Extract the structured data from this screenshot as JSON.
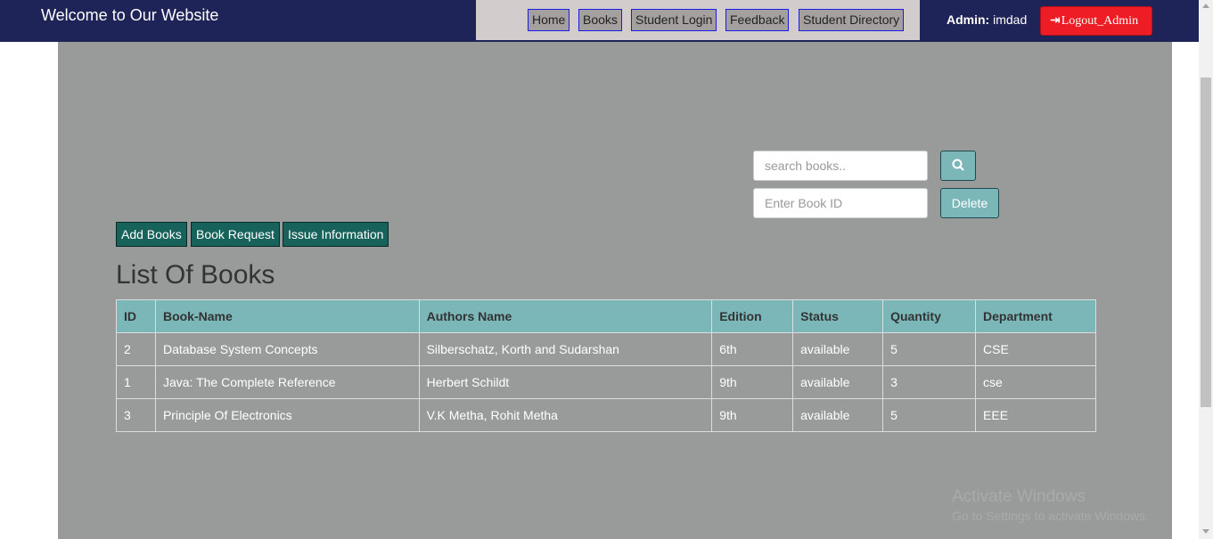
{
  "header": {
    "site_title": "Welcome to Our Website",
    "nav": [
      "Home",
      "Books",
      "Student Login",
      "Feedback",
      "Student Directory"
    ],
    "admin_label": "Admin:",
    "admin_name": "imdad",
    "logout_label": "Logout_Admin",
    "logout_icon": "sign-out-icon"
  },
  "search": {
    "placeholder": "search books..",
    "button_icon": "search-icon"
  },
  "delete": {
    "placeholder": "Enter Book ID",
    "button_label": "Delete"
  },
  "actions": [
    "Add Books",
    "Book Request",
    "Issue Information"
  ],
  "list_title": "List Of Books",
  "table": {
    "columns": [
      "ID",
      "Book-Name",
      "Authors Name",
      "Edition",
      "Status",
      "Quantity",
      "Department"
    ],
    "rows": [
      [
        "2",
        "Database System Concepts",
        "Silberschatz, Korth and Sudarshan",
        "6th",
        "available",
        "5",
        "CSE"
      ],
      [
        "1",
        "Java: The Complete Reference",
        "Herbert Schildt",
        "9th",
        "available",
        "3",
        "cse"
      ],
      [
        "3",
        "Principle Of Electronics",
        "V.K Metha, Rohit Metha",
        "9th",
        "available",
        "5",
        "EEE"
      ]
    ]
  },
  "watermark": {
    "line1": "Activate Windows",
    "line2": "Go to Settings to activate Windows."
  },
  "colors": {
    "header_bg": "#1e2457",
    "content_bg": "#999b9b",
    "accent_teal": "#7bb7b8",
    "action_green": "#17625b",
    "logout_red": "#ee1c24"
  }
}
